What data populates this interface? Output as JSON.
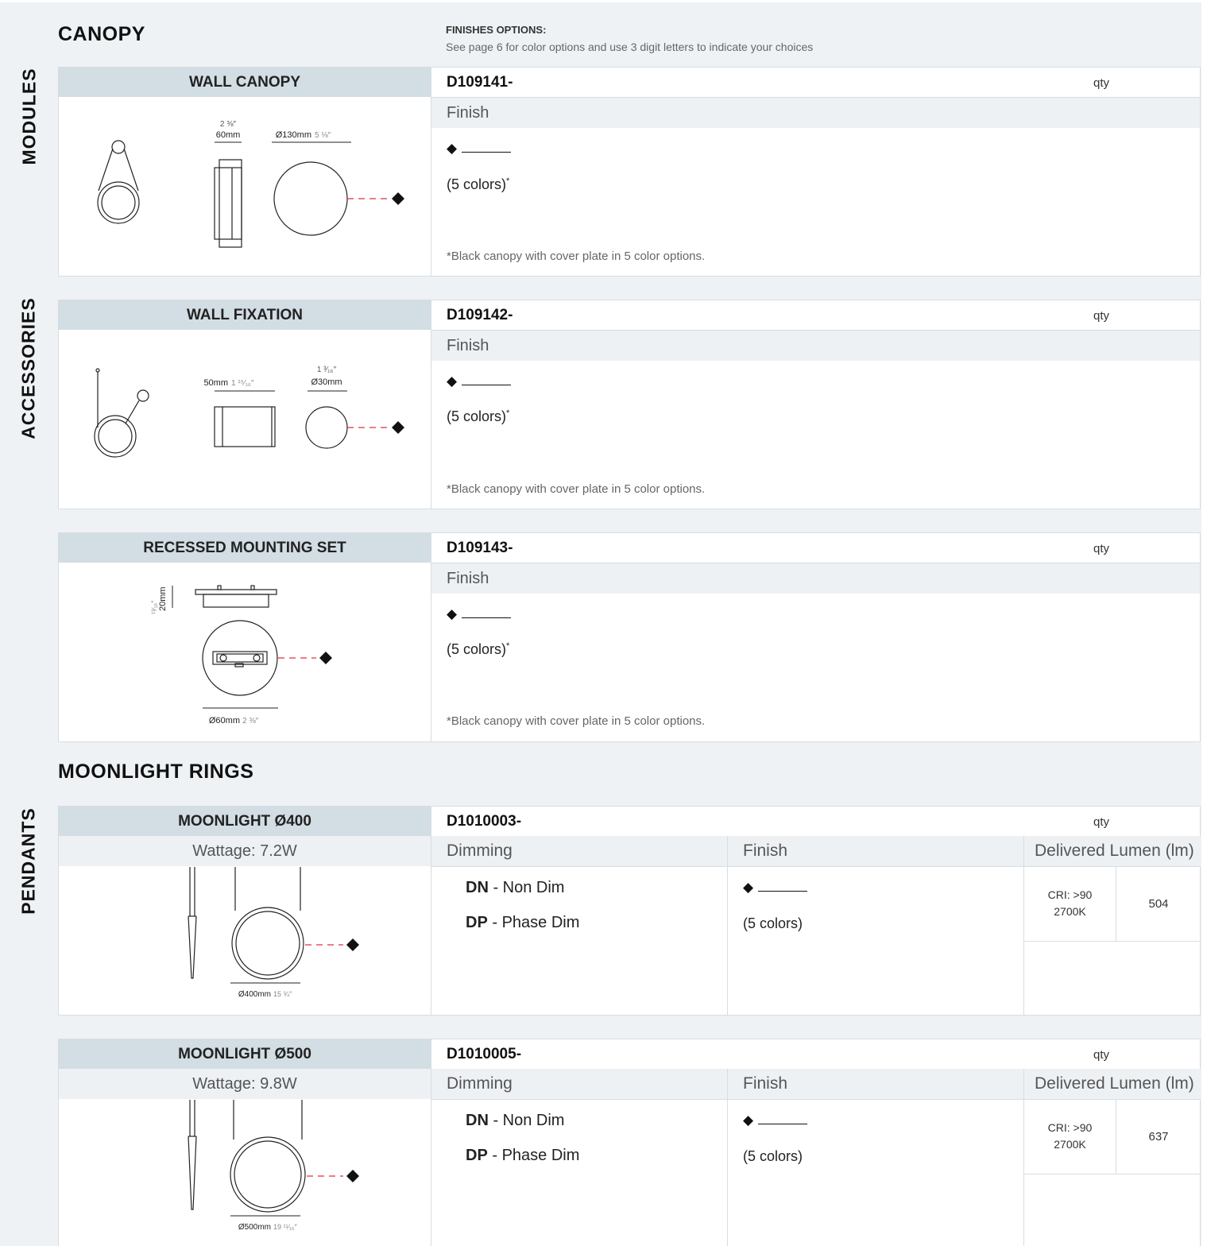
{
  "side_labels": {
    "modules": "MODULES",
    "accessories": "ACCESSORIES",
    "pendants": "PENDANTS"
  },
  "sections": {
    "canopy": "CANOPY",
    "rings": "MOONLIGHT RINGS"
  },
  "finishes_options": {
    "title": "FINISHES OPTIONS:",
    "subtitle": "See page 6 for color options and use 3 digit letters to indicate your choices"
  },
  "cards": [
    {
      "name": "WALL CANOPY",
      "code": "D109141-",
      "qty": "qty",
      "finish": "Finish",
      "swatch": "◆",
      "colors": "(5 colors)",
      "star": "*",
      "note": "*Black canopy with cover plate in 5 color options.",
      "dims": {
        "top_frac": "2 ⅜″",
        "depth": "60mm",
        "dia": "Ø130mm",
        "dia_in": "5 ⅛″"
      }
    },
    {
      "name": "WALL FIXATION",
      "code": "D109142-",
      "qty": "qty",
      "finish": "Finish",
      "swatch": "◆",
      "colors": "(5 colors)",
      "star": "*",
      "note": "*Black canopy with cover plate in 5 color options.",
      "dims": {
        "depth": "50mm",
        "depth_in": "1 ¹⁵⁄₁₆″",
        "top_frac": "1 ³⁄₁₆″",
        "dia": "Ø30mm"
      }
    },
    {
      "name": "RECESSED MOUNTING SET",
      "code": "D109143-",
      "qty": "qty",
      "finish": "Finish",
      "swatch": "◆",
      "colors": "(5 colors)",
      "star": "*",
      "note": "*Black canopy with cover plate in 5 color options.",
      "dims": {
        "height": "20mm",
        "height_in": "¹³⁄₁₆″",
        "dia": "Ø60mm",
        "dia_in": "2 ⅜″"
      }
    }
  ],
  "pendants": [
    {
      "name": "MOONLIGHT Ø400",
      "code": "D1010003-",
      "qty": "qty",
      "wattage": "Wattage: 7.2W",
      "dimming_h": "Dimming",
      "finish_h": "Finish",
      "lumen_h": "Delivered Lumen (lm)",
      "dn_code": "DN",
      "dn_text": " - Non Dim",
      "dp_code": "DP",
      "dp_text": " - Phase Dim",
      "swatch": "◆",
      "colors": "(5 colors)",
      "cri": "CRI: >90",
      "cct": "2700K",
      "lumen": "504",
      "dim_label": "Ø400mm",
      "dim_in": "15 ¾″"
    },
    {
      "name": "MOONLIGHT Ø500",
      "code": "D1010005-",
      "qty": "qty",
      "wattage": "Wattage: 9.8W",
      "dimming_h": "Dimming",
      "finish_h": "Finish",
      "lumen_h": "Delivered Lumen (lm)",
      "dn_code": "DN",
      "dn_text": " - Non Dim",
      "dp_code": "DP",
      "dp_text": " - Phase Dim",
      "swatch": "◆",
      "colors": "(5 colors)",
      "cri": "CRI: >90",
      "cct": "2700K",
      "lumen": "637",
      "dim_label": "Ø500mm",
      "dim_in": "19 ¹¹⁄₁₆″"
    }
  ],
  "colors": {
    "header_bg": "#d3dde4",
    "sub_bg": "#eef1f4",
    "page_bg": "#eff2f5",
    "leader": "#e0303a"
  }
}
